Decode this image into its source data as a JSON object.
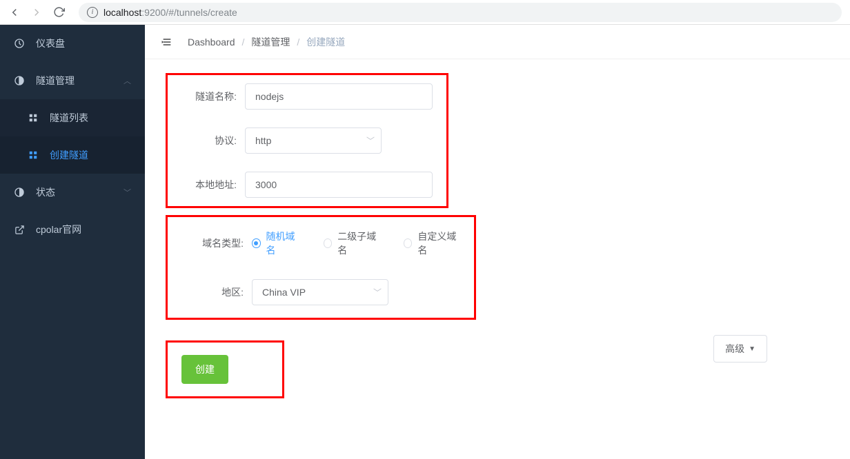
{
  "browser": {
    "url_host": "localhost",
    "url_port_path": ":9200/#/tunnels/create"
  },
  "sidebar": {
    "items": [
      {
        "label": "仪表盘",
        "icon": "dashboard"
      },
      {
        "label": "隧道管理",
        "icon": "adjust",
        "expanded": true,
        "children": [
          {
            "label": "隧道列表"
          },
          {
            "label": "创建隧道",
            "active": true
          }
        ]
      },
      {
        "label": "状态",
        "icon": "adjust"
      },
      {
        "label": "cpolar官网",
        "icon": "external"
      }
    ]
  },
  "breadcrumb": {
    "items": [
      "Dashboard",
      "隧道管理",
      "创建隧道"
    ]
  },
  "form": {
    "tunnel_name_label": "隧道名称:",
    "tunnel_name_value": "nodejs",
    "protocol_label": "协议:",
    "protocol_value": "http",
    "local_addr_label": "本地地址:",
    "local_addr_value": "3000",
    "domain_type_label": "域名类型:",
    "domain_options": [
      {
        "label": "随机域名",
        "checked": true
      },
      {
        "label": "二级子域名",
        "checked": false
      },
      {
        "label": "自定义域名",
        "checked": false
      }
    ],
    "region_label": "地区:",
    "region_value": "China VIP",
    "advanced_label": "高级",
    "create_label": "创建"
  }
}
